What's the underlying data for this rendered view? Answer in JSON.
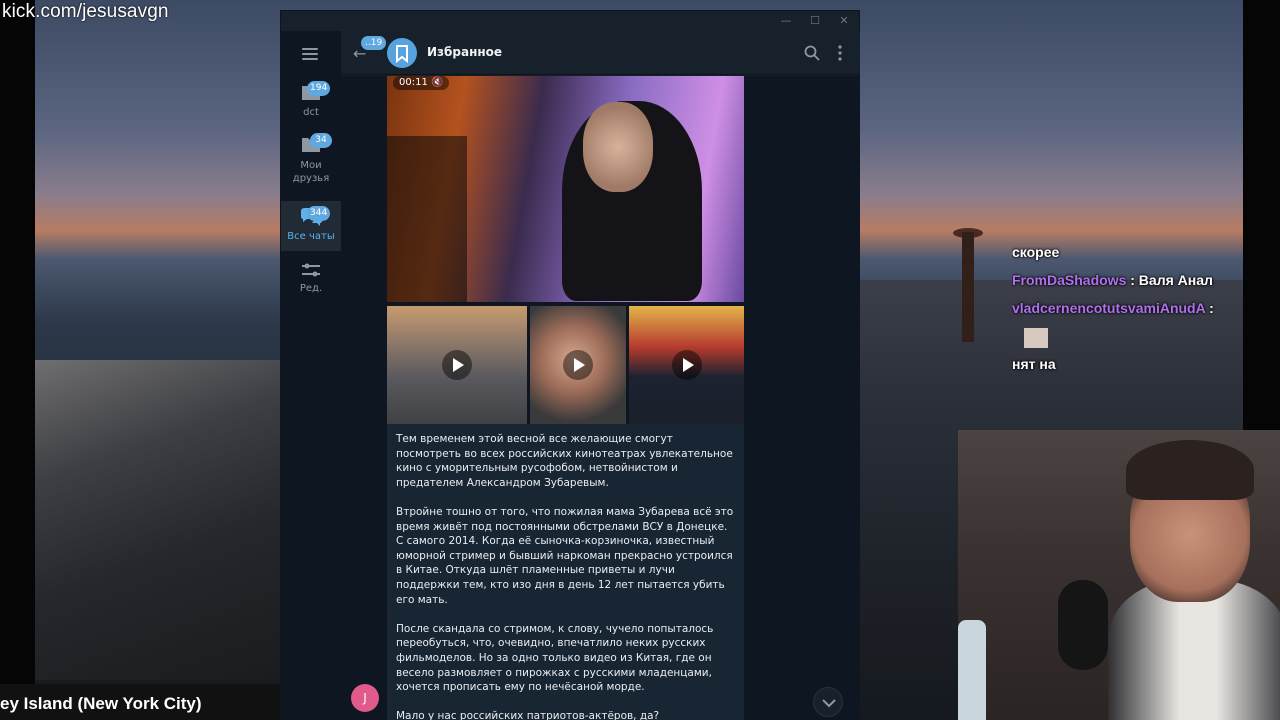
{
  "stream": {
    "url": "kick.com/jesusavgn",
    "location": "ey Island (New York City)"
  },
  "chat_overlay": [
    {
      "user": "",
      "text": "скорее"
    },
    {
      "user": "FromDaShadows",
      "text": ": Валя Анал"
    },
    {
      "user": "vladcernencotutsvamiAnudA",
      "text": ":"
    },
    {
      "user": "",
      "text": ""
    },
    {
      "user": "",
      "text": "нят на"
    }
  ],
  "telegram": {
    "sidebar": {
      "folders": [
        {
          "label": "dct",
          "badge": "194"
        },
        {
          "label": "Мои\nдрузья",
          "badge": "34"
        },
        {
          "label": "Все чаты",
          "badge": "344",
          "active": true
        },
        {
          "label": "Ред."
        }
      ]
    },
    "header": {
      "back_badge": "..19",
      "title": "Избранное"
    },
    "media": {
      "duration": "00:11"
    },
    "message": {
      "paragraphs": [
        "Тем временем этой весной все желающие смогут посмотреть во всех российских кинотеатрах увлекательное кино с уморительным русофобом, нетвойнистом и предателем Александром Зубаревым.",
        "Втройне тошно от того, что пожилая мама Зубарева всё это время живёт под постоянными обстрелами ВСУ в Донецке. С самого 2014. Когда её сыночка-корзиночка, известный юморной стример и бывший наркоман прекрасно устроился в Китае. Откуда шлёт пламенные приветы и лучи поддержки тем, кто изо дня в день 12 лет пытается убить его мать.",
        "После скандала со стримом, к слову, чучело попыталось переобуться, что, очевидно, впечатлило неких русских фильмоделов. Но за одно только видео из Китая, где он весело размовляет о пирожках с русскими младенцами, хочется прописать ему по нечёсаной морде.",
        "Мало у нас российских патриотов-актёров, да?"
      ]
    },
    "user_avatar_letter": "J"
  },
  "colors": {
    "accent": "#5fa8e0",
    "chat_user": "#b070f0",
    "tg_bg": "#0e1621",
    "tg_panel": "#17212b",
    "msg_bubble": "#182533"
  }
}
